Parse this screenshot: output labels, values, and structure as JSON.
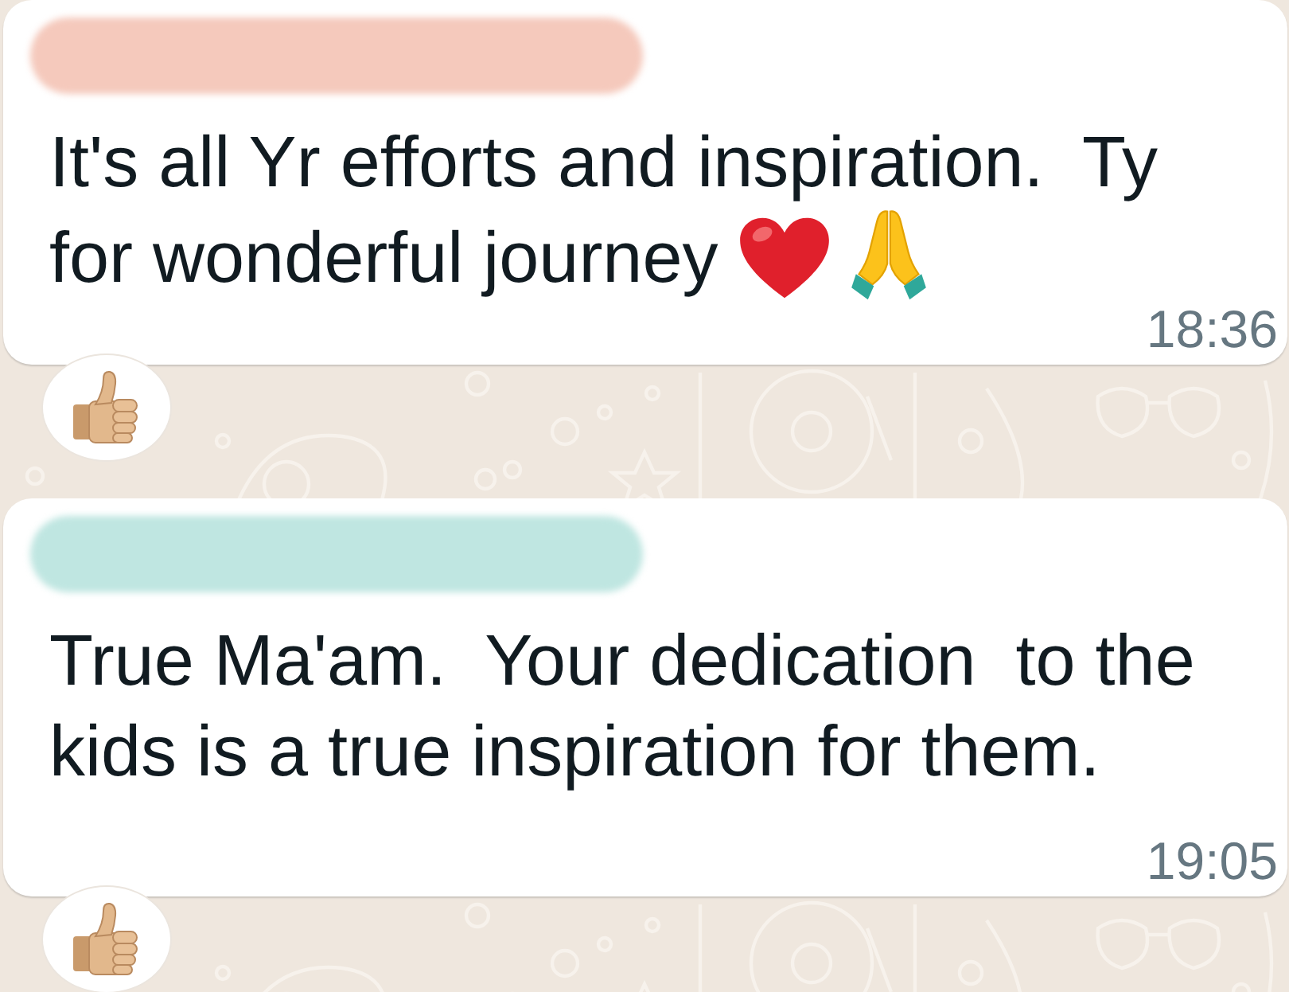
{
  "chat": {
    "messages": [
      {
        "color": "#f5c9bc",
        "text": "It's all Yr efforts and inspiration.  Ty for wonderful journey",
        "emoji": [
          {
            "kind": "red_heart"
          },
          {
            "kind": "folded_hands"
          }
        ],
        "time": "18:36",
        "reactions": [
          {
            "kind": "thumbs_up"
          }
        ]
      },
      {
        "color": "#bfe6e1",
        "text": "True Ma'am.  Your dedication  to the kids is a true inspiration for them.",
        "time": "19:05",
        "reactions": [
          {
            "kind": "thumbs_up"
          }
        ]
      }
    ]
  }
}
